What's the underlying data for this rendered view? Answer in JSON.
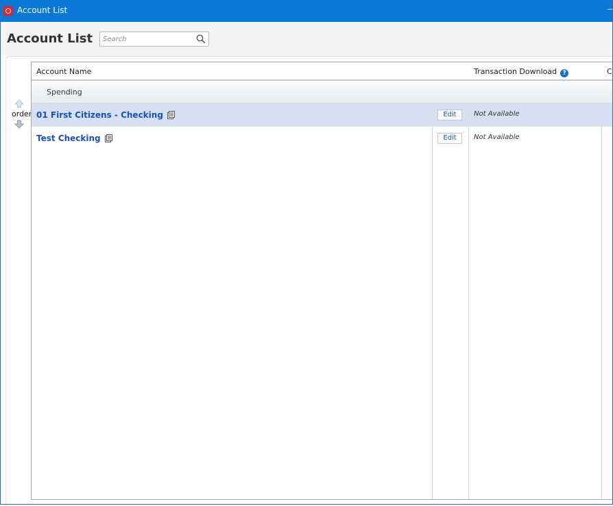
{
  "window": {
    "title": "Account List"
  },
  "header": {
    "page_title": "Account List",
    "search_placeholder": "Search"
  },
  "order": {
    "label": "order"
  },
  "table": {
    "columns": [
      "Account Name",
      "",
      "Transaction Download",
      "C"
    ],
    "groups": [
      {
        "name": "Spending",
        "accounts": [
          {
            "name": "01 First Citizens - Checking",
            "edit_label": "Edit",
            "download_status": "Not Available",
            "selected": true
          },
          {
            "name": "Test Checking",
            "edit_label": "Edit",
            "download_status": "Not Available",
            "selected": false
          }
        ]
      }
    ]
  },
  "colors": {
    "titlebar": "#0a78d7",
    "link": "#1a4fc2",
    "selected_row": "#d5e0f1",
    "logo": "#e8202f"
  },
  "icons": [
    "app-logo-icon",
    "minimize-icon",
    "search-icon",
    "help-icon",
    "arrow-up-icon",
    "arrow-down-icon",
    "account-details-icon"
  ]
}
